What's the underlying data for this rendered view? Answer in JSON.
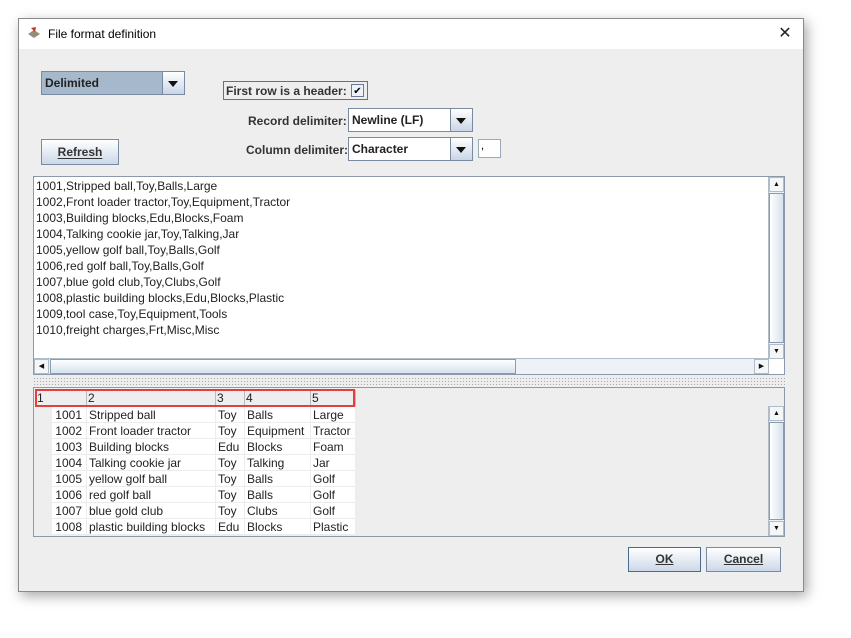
{
  "window": {
    "title": "File format definition",
    "close_glyph": "✕"
  },
  "format_combo": {
    "value": "Delimited"
  },
  "header_checkbox": {
    "label": "First row is a header:",
    "checked": true,
    "glyph": "✔"
  },
  "record_delimiter": {
    "label": "Record delimiter:",
    "value": "Newline (LF)"
  },
  "column_delimiter": {
    "label": "Column delimiter:",
    "value": "Character",
    "char": ","
  },
  "refresh_button": {
    "label": "Refresh"
  },
  "raw_lines": [
    "1001,Stripped ball,Toy,Balls,Large",
    "1002,Front loader tractor,Toy,Equipment,Tractor",
    "1003,Building blocks,Edu,Blocks,Foam",
    "1004,Talking cookie jar,Toy,Talking,Jar",
    "1005,yellow golf ball,Toy,Balls,Golf",
    "1006,red golf ball,Toy,Balls,Golf",
    "1007,blue gold club,Toy,Clubs,Golf",
    "1008,plastic building blocks,Edu,Blocks,Plastic",
    "1009,tool case,Toy,Equipment,Tools",
    "1010,freight charges,Frt,Misc,Misc"
  ],
  "table": {
    "headers": [
      "1",
      "2",
      "3",
      "4",
      "5"
    ],
    "rows": [
      [
        "1001",
        "Stripped ball",
        "Toy",
        "Balls",
        "Large"
      ],
      [
        "1002",
        "Front loader tractor",
        "Toy",
        "Equipment",
        "Tractor"
      ],
      [
        "1003",
        "Building blocks",
        "Edu",
        "Blocks",
        "Foam"
      ],
      [
        "1004",
        "Talking cookie jar",
        "Toy",
        "Talking",
        "Jar"
      ],
      [
        "1005",
        "yellow golf ball",
        "Toy",
        "Balls",
        "Golf"
      ],
      [
        "1006",
        "red golf ball",
        "Toy",
        "Balls",
        "Golf"
      ],
      [
        "1007",
        "blue gold club",
        "Toy",
        "Clubs",
        "Golf"
      ],
      [
        "1008",
        "plastic building blocks",
        "Edu",
        "Blocks",
        "Plastic"
      ]
    ]
  },
  "buttons": {
    "ok": "OK",
    "cancel": "Cancel"
  }
}
